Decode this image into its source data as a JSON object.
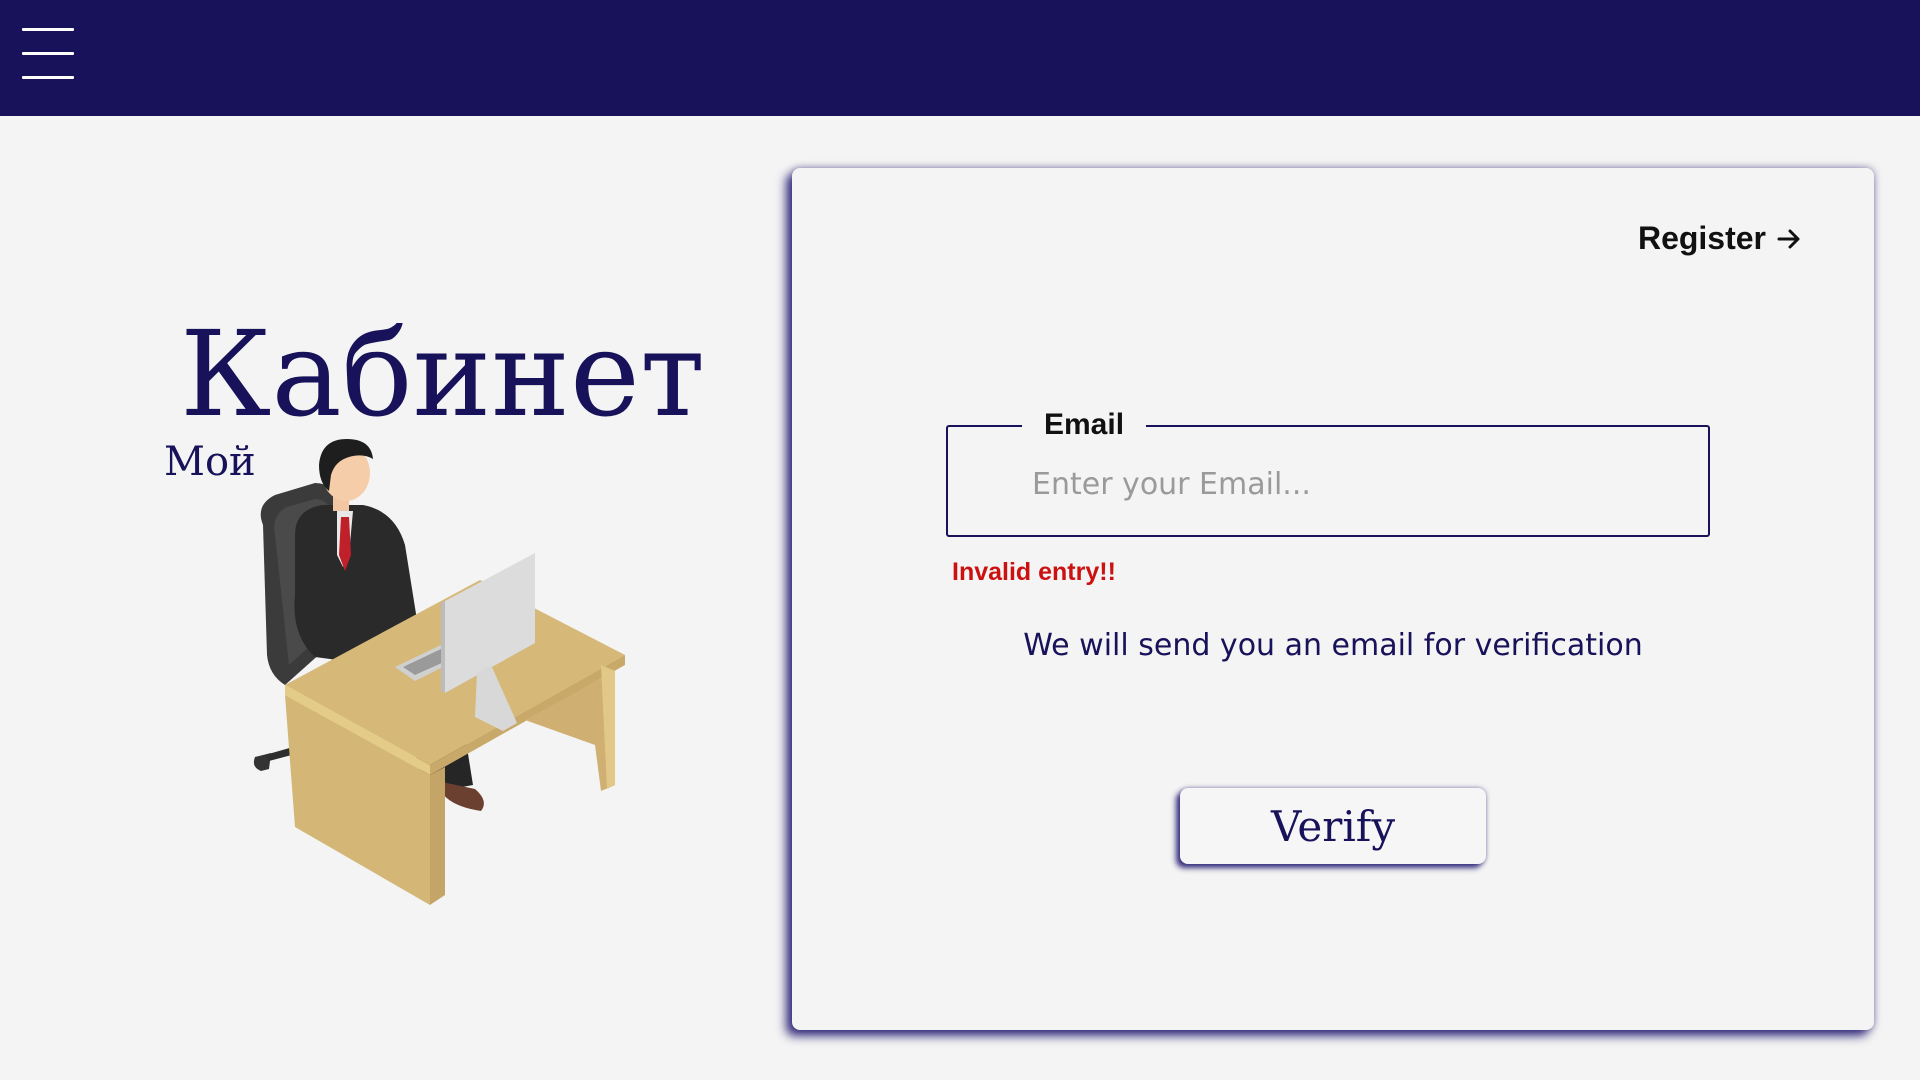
{
  "header": {
    "menu_icon": "hamburger-menu-icon",
    "background_color": "#171259"
  },
  "brand": {
    "title_main": "Кабинет",
    "title_small": "Мой"
  },
  "illustration": {
    "icon": "man-at-desk-illustration"
  },
  "card": {
    "register_label": "Register",
    "register_icon": "arrow-right-icon",
    "email_label": "Email",
    "email_placeholder": "Enter your Email...",
    "email_value": "",
    "error_message": "Invalid entry!!",
    "hint": "We will send you an email for verification",
    "verify_label": "Verify"
  },
  "colors": {
    "accent": "#171259",
    "error": "#cc1111",
    "background": "#f4f4f4"
  }
}
